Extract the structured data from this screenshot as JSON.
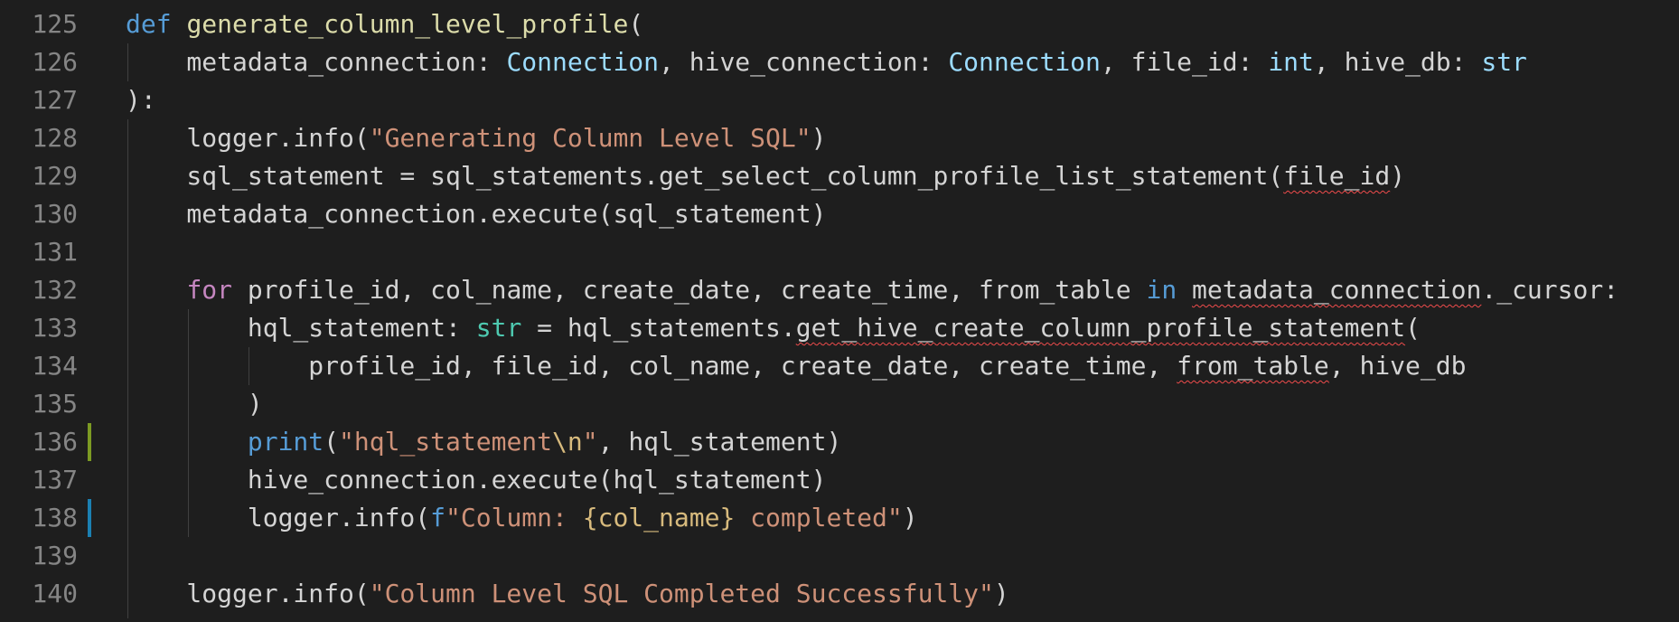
{
  "editor": {
    "lines": [
      {
        "no": "125",
        "tokens": [
          [
            "kw",
            "def"
          ],
          [
            "pl",
            " "
          ],
          [
            "fn",
            "generate_column_level_profile"
          ],
          [
            "pl",
            "("
          ]
        ]
      },
      {
        "no": "126",
        "tokens": [
          [
            "pl",
            "    metadata_connection: "
          ],
          [
            "ty",
            "Connection"
          ],
          [
            "pl",
            ", hive_connection: "
          ],
          [
            "ty",
            "Connection"
          ],
          [
            "pl",
            ", file_id: "
          ],
          [
            "ty",
            "int"
          ],
          [
            "pl",
            ","
          ],
          [
            "pl",
            " hive_db: "
          ],
          [
            "ty",
            "str"
          ]
        ]
      },
      {
        "no": "127",
        "tokens": [
          [
            "pl",
            "):"
          ]
        ]
      },
      {
        "no": "128",
        "tokens": [
          [
            "pl",
            "    logger.info("
          ],
          [
            "str",
            "\"Generating Column Level SQL\""
          ],
          [
            "pl",
            ")"
          ]
        ]
      },
      {
        "no": "129",
        "tokens": [
          [
            "pl",
            "    sql_statement = sql_statements.get_select_column_profile_list_statement("
          ],
          [
            "sq",
            "file_id"
          ],
          [
            "pl",
            ")"
          ]
        ]
      },
      {
        "no": "130",
        "tokens": [
          [
            "pl",
            "    metadata_connection.execute(sql_statement)"
          ]
        ]
      },
      {
        "no": "131",
        "tokens": []
      },
      {
        "no": "132",
        "tokens": [
          [
            "pl",
            "    "
          ],
          [
            "ctl",
            "for"
          ],
          [
            "pl",
            " profile_id, col_name, create_date, create_time, from_table "
          ],
          [
            "kw",
            "in"
          ],
          [
            "pl",
            " "
          ],
          [
            "sq",
            "metadata_connection"
          ],
          [
            "pl",
            "._cursor:"
          ]
        ]
      },
      {
        "no": "133",
        "tokens": [
          [
            "pl",
            "        hql_statement: "
          ],
          [
            "tyg",
            "str"
          ],
          [
            "pl",
            " = hql_statements."
          ],
          [
            "sq",
            "get_hive_create_column_profile_statement"
          ],
          [
            "pl",
            "("
          ]
        ]
      },
      {
        "no": "134",
        "tokens": [
          [
            "pl",
            "            profile_id, file_id, col_name, create_date, create_time, "
          ],
          [
            "sq",
            "from_table"
          ],
          [
            "pl",
            ", hive_db"
          ]
        ]
      },
      {
        "no": "135",
        "tokens": [
          [
            "pl",
            "        )"
          ]
        ]
      },
      {
        "no": "136",
        "tokens": [
          [
            "pl",
            "        "
          ],
          [
            "kw",
            "print"
          ],
          [
            "pl",
            "("
          ],
          [
            "str",
            "\"hql_statement"
          ],
          [
            "esc",
            "\\n"
          ],
          [
            "str",
            "\""
          ],
          [
            "pl",
            ", hql_statement)"
          ]
        ]
      },
      {
        "no": "137",
        "tokens": [
          [
            "pl",
            "        hive_connection.execute(hql_statement)"
          ]
        ]
      },
      {
        "no": "138",
        "tokens": [
          [
            "pl",
            "        logger.info("
          ],
          [
            "kw",
            "f"
          ],
          [
            "str",
            "\"Column: "
          ],
          [
            "esc",
            "{col_name}"
          ],
          [
            "str",
            " completed\""
          ],
          [
            "pl",
            ")"
          ]
        ]
      },
      {
        "no": "139",
        "tokens": []
      },
      {
        "no": "140",
        "tokens": [
          [
            "pl",
            "    logger.info("
          ],
          [
            "str",
            "\"Column Level SQL Completed Successfully\""
          ],
          [
            "pl",
            ")"
          ]
        ]
      }
    ],
    "gutter_marks": [
      {
        "line": "136",
        "color": "#7c9a23",
        "kind": "modified"
      },
      {
        "line": "138",
        "color": "#1b80b2",
        "kind": "added"
      }
    ]
  }
}
